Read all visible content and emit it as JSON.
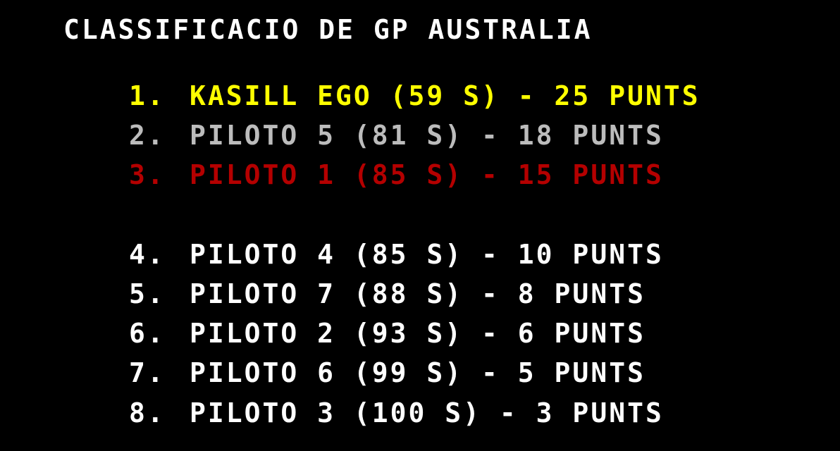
{
  "title": "CLASSIFICACIO DE GP AUSTRALIA",
  "standings": [
    {
      "pos": "1.",
      "text": "KASILL EGO (59 S) - 25 PUNTS",
      "color": "#ffff00"
    },
    {
      "pos": "2.",
      "text": "PILOTO 5 (81 S) - 18 PUNTS",
      "color": "#bcbcbc"
    },
    {
      "pos": "3.",
      "text": "PILOTO 1 (85 S) - 15 PUNTS",
      "color": "#b40000"
    },
    {
      "pos": "4.",
      "text": "PILOTO 4 (85 S) - 10 PUNTS",
      "color": "#ffffff"
    },
    {
      "pos": "5.",
      "text": "PILOTO 7 (88 S) - 8 PUNTS",
      "color": "#ffffff"
    },
    {
      "pos": "6.",
      "text": "PILOTO 2 (93 S) - 6 PUNTS",
      "color": "#ffffff"
    },
    {
      "pos": "7.",
      "text": "PILOTO 6 (99 S) - 5 PUNTS",
      "color": "#ffffff"
    },
    {
      "pos": "8.",
      "text": "PILOTO 3 (100 S) - 3 PUNTS",
      "color": "#ffffff"
    }
  ]
}
